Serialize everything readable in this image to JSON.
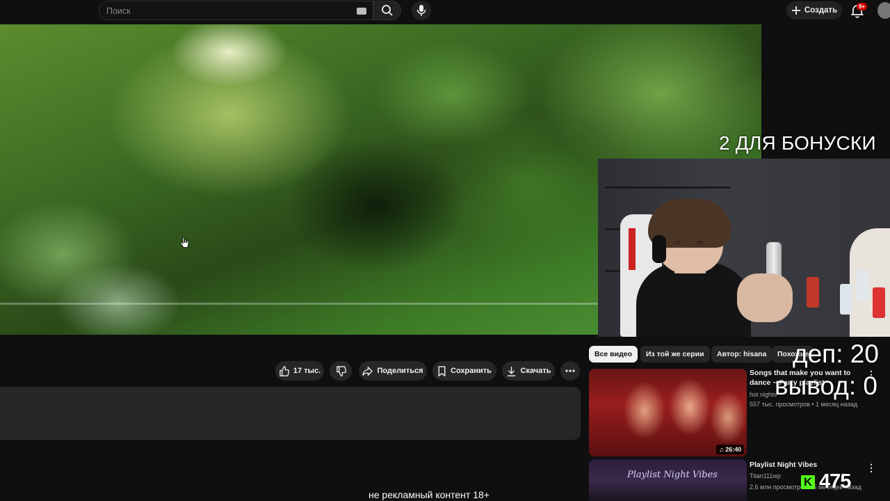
{
  "header": {
    "search_placeholder": "Поиск",
    "create_label": "Создать",
    "notification_badge": "9+"
  },
  "player": {
    "overlay_bonus": "2 ДЛЯ БОНУСКИ"
  },
  "actions": {
    "likes": "17 тыс.",
    "share": "Поделиться",
    "save": "Сохранить",
    "download": "Скачать"
  },
  "recommendations": {
    "chips": [
      "Все видео",
      "Из той же серии",
      "Автор: hisana",
      "Похожие"
    ],
    "videos": [
      {
        "title_line1": "Songs that make you want to",
        "title_line2": "dance ~ Party playlist",
        "channel": "hot nights",
        "meta": "557 тыс. просмотров • 1 месяц назад",
        "duration": "26:40"
      },
      {
        "title": "Playlist Night Vibes",
        "channel": "Titan111wp",
        "meta": "2,6 млн просмотров • 5 месяцев назад",
        "thumb_text": "Playlist Night Vibes"
      }
    ]
  },
  "overlay": {
    "dep": "деп: 20",
    "vyvod": "вывод: 0",
    "kick_count": "475",
    "kick_letter": "K",
    "subtitle": "не рекламный контент 18+"
  },
  "colors": {
    "background": "#0f0f0f",
    "badge": "#cc0000",
    "kick_green": "#53fc18"
  }
}
